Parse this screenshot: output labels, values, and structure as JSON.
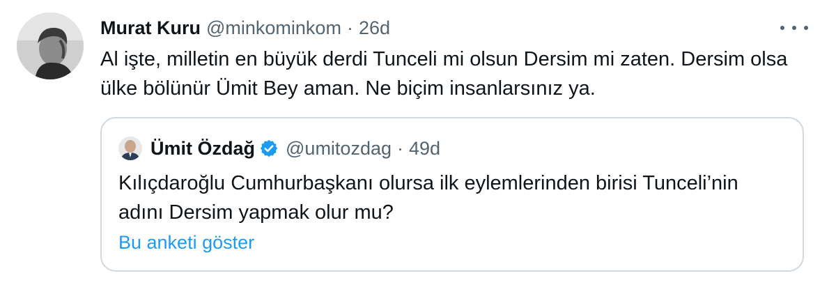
{
  "tweet": {
    "author_name": "Murat Kuru",
    "author_handle": "@minkominkom",
    "separator": "·",
    "time": "26d",
    "text": "Al işte, milletin en büyük derdi Tunceli mi olsun Dersim mi zaten. Dersim olsa ülke bölünür Ümit Bey aman. Ne biçim insanlarsınız ya.",
    "more_icon": "more-horizontal-icon"
  },
  "quote": {
    "author_name": "Ümit Özdağ",
    "verified_icon": "verified-badge-icon",
    "author_handle": "@umitozdag",
    "separator": "·",
    "time": "49d",
    "text": "Kılıçdaroğlu Cumhurbaşkanı olursa ilk eylemlerinden birisi Tunceli’nin adını Dersim yapmak olur mu?",
    "poll_link": "Bu anketi göster"
  },
  "colors": {
    "text_primary": "#0f1419",
    "text_secondary": "#536471",
    "link": "#1d9bf0",
    "border": "#cfd9de",
    "verified": "#1d9bf0"
  }
}
